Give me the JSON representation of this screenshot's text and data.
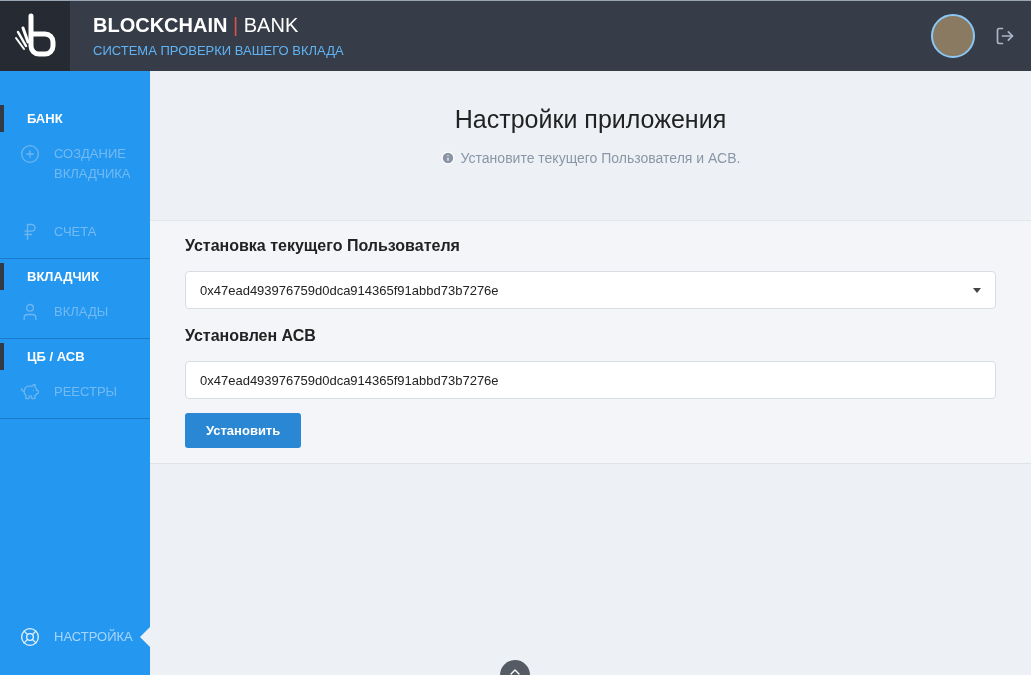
{
  "header": {
    "brand": "BLOCKCHAIN",
    "brand_separator": "|",
    "brand_suffix": "BANK",
    "subtitle": "СИСТЕМА ПРОВЕРКИ ВАШЕГО ВКЛАДА"
  },
  "sidebar": {
    "sections": [
      {
        "title": "БАНК",
        "items": [
          {
            "label": "СОЗДАНИЕ ВКЛАДЧИКА",
            "kind": "plus",
            "selected": false
          },
          {
            "label": "СЧЕТА",
            "kind": "ruble",
            "selected": false
          }
        ]
      },
      {
        "title": "ВКЛАДЧИК",
        "items": [
          {
            "label": "ВКЛАДЫ",
            "kind": "user",
            "selected": false
          }
        ]
      },
      {
        "title": "ЦБ / АСВ",
        "items": [
          {
            "label": "РЕЕСТРЫ",
            "kind": "piggy",
            "selected": false
          }
        ]
      }
    ],
    "bottom_item": {
      "label": "НАСТРОЙКА",
      "kind": "lifebuoy",
      "selected": true
    }
  },
  "page": {
    "title": "Настройки приложения",
    "hint": "Установите текущего Пользователя и АСВ."
  },
  "form": {
    "user_label": "Установка текущего Пользователя",
    "user_value": "0x47ead493976759d0dca914365f91abbd73b7276e",
    "asv_label": "Установлен АСВ",
    "asv_value": "0x47ead493976759d0dca914365f91abbd73b7276e",
    "submit": "Установить"
  }
}
